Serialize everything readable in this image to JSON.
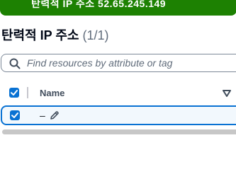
{
  "flash": {
    "text": "탄력적 IP 주소 52.65.245.149",
    "color": "#1d8102"
  },
  "header": {
    "title": "탄력적 IP 주소",
    "count": "(1/1)"
  },
  "search": {
    "placeholder": "Find resources by attribute or tag",
    "value": "",
    "icon": "search-icon"
  },
  "table": {
    "columns": [
      {
        "label": "Name"
      }
    ],
    "rows": [
      {
        "name": "–",
        "selected": true
      }
    ]
  },
  "colors": {
    "accent": "#0972d3",
    "selected_row_bg": "#f2f8fd"
  }
}
